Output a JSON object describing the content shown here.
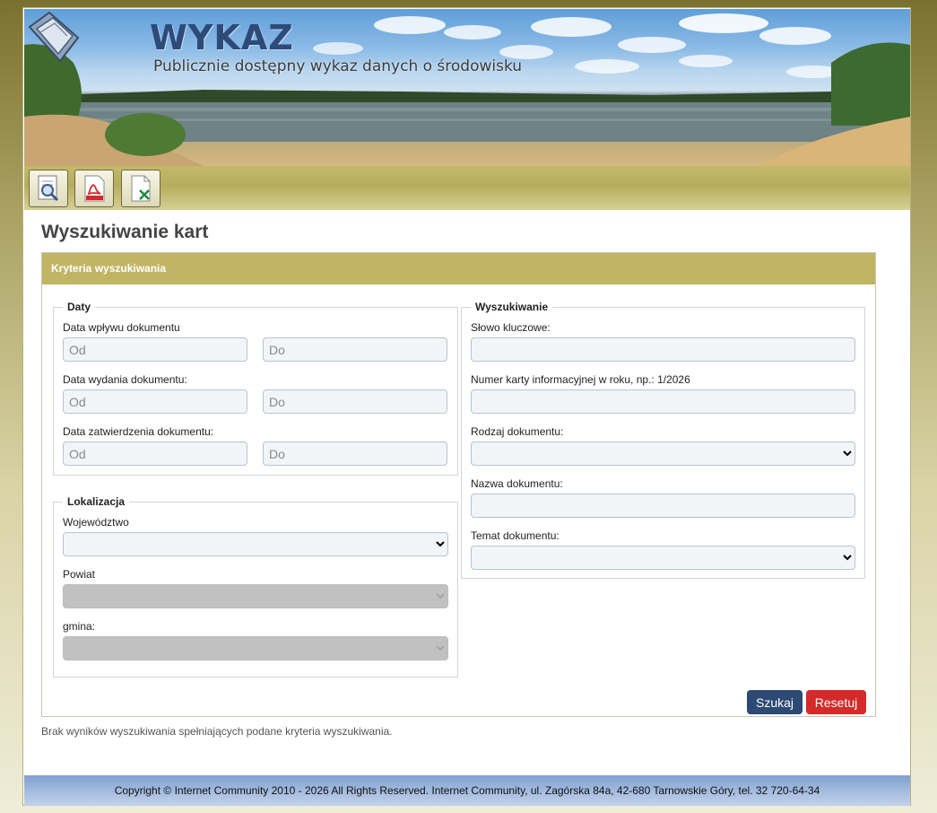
{
  "header": {
    "title": "WYKAZ",
    "subtitle": "Publicznie dostępny wykaz danych o środowisku"
  },
  "toolbar": {
    "buttons": [
      {
        "icon": "search-icon"
      },
      {
        "icon": "pdf-icon"
      },
      {
        "icon": "excel-icon"
      }
    ]
  },
  "page_title": "Wyszukiwanie kart",
  "panel": {
    "title": "Kryteria wyszukiwania",
    "daty": {
      "legend": "Daty",
      "wplyw_label": "Data wpływu dokumentu",
      "wydanie_label": "Data wydania dokumentu:",
      "zatwierdzenie_label": "Data zatwierdzenia dokumentu:",
      "from_placeholder": "Od",
      "to_placeholder": "Do"
    },
    "lokalizacja": {
      "legend": "Lokalizacja",
      "wojewodztwo_label": "Województwo",
      "powiat_label": "Powiat",
      "gmina_label": "gmina:"
    },
    "wyszukiwanie": {
      "legend": "Wyszukiwanie",
      "slowo_label": "Słowo kluczowe:",
      "numer_label": "Numer karty informacyjnej w roku, np.: 1/2026",
      "rodzaj_label": "Rodzaj dokumentu:",
      "nazwa_label": "Nazwa dokumentu:",
      "temat_label": "Temat dokumentu:"
    },
    "search_button": "Szukaj",
    "reset_button": "Resetuj"
  },
  "result_message": "Brak wyników wyszukiwania spełniających podane kryteria wyszukiwania.",
  "footer": "Copyright © Internet Community 2010 - 2026 All Rights Reserved. Internet Community, ul. Zagórska 84a, 42-680 Tarnowskie Góry, tel. 32 720-64-34",
  "colors": {
    "accent": "#c1b564",
    "search_button": "#2c4a73",
    "reset_button": "#d42a2a"
  }
}
